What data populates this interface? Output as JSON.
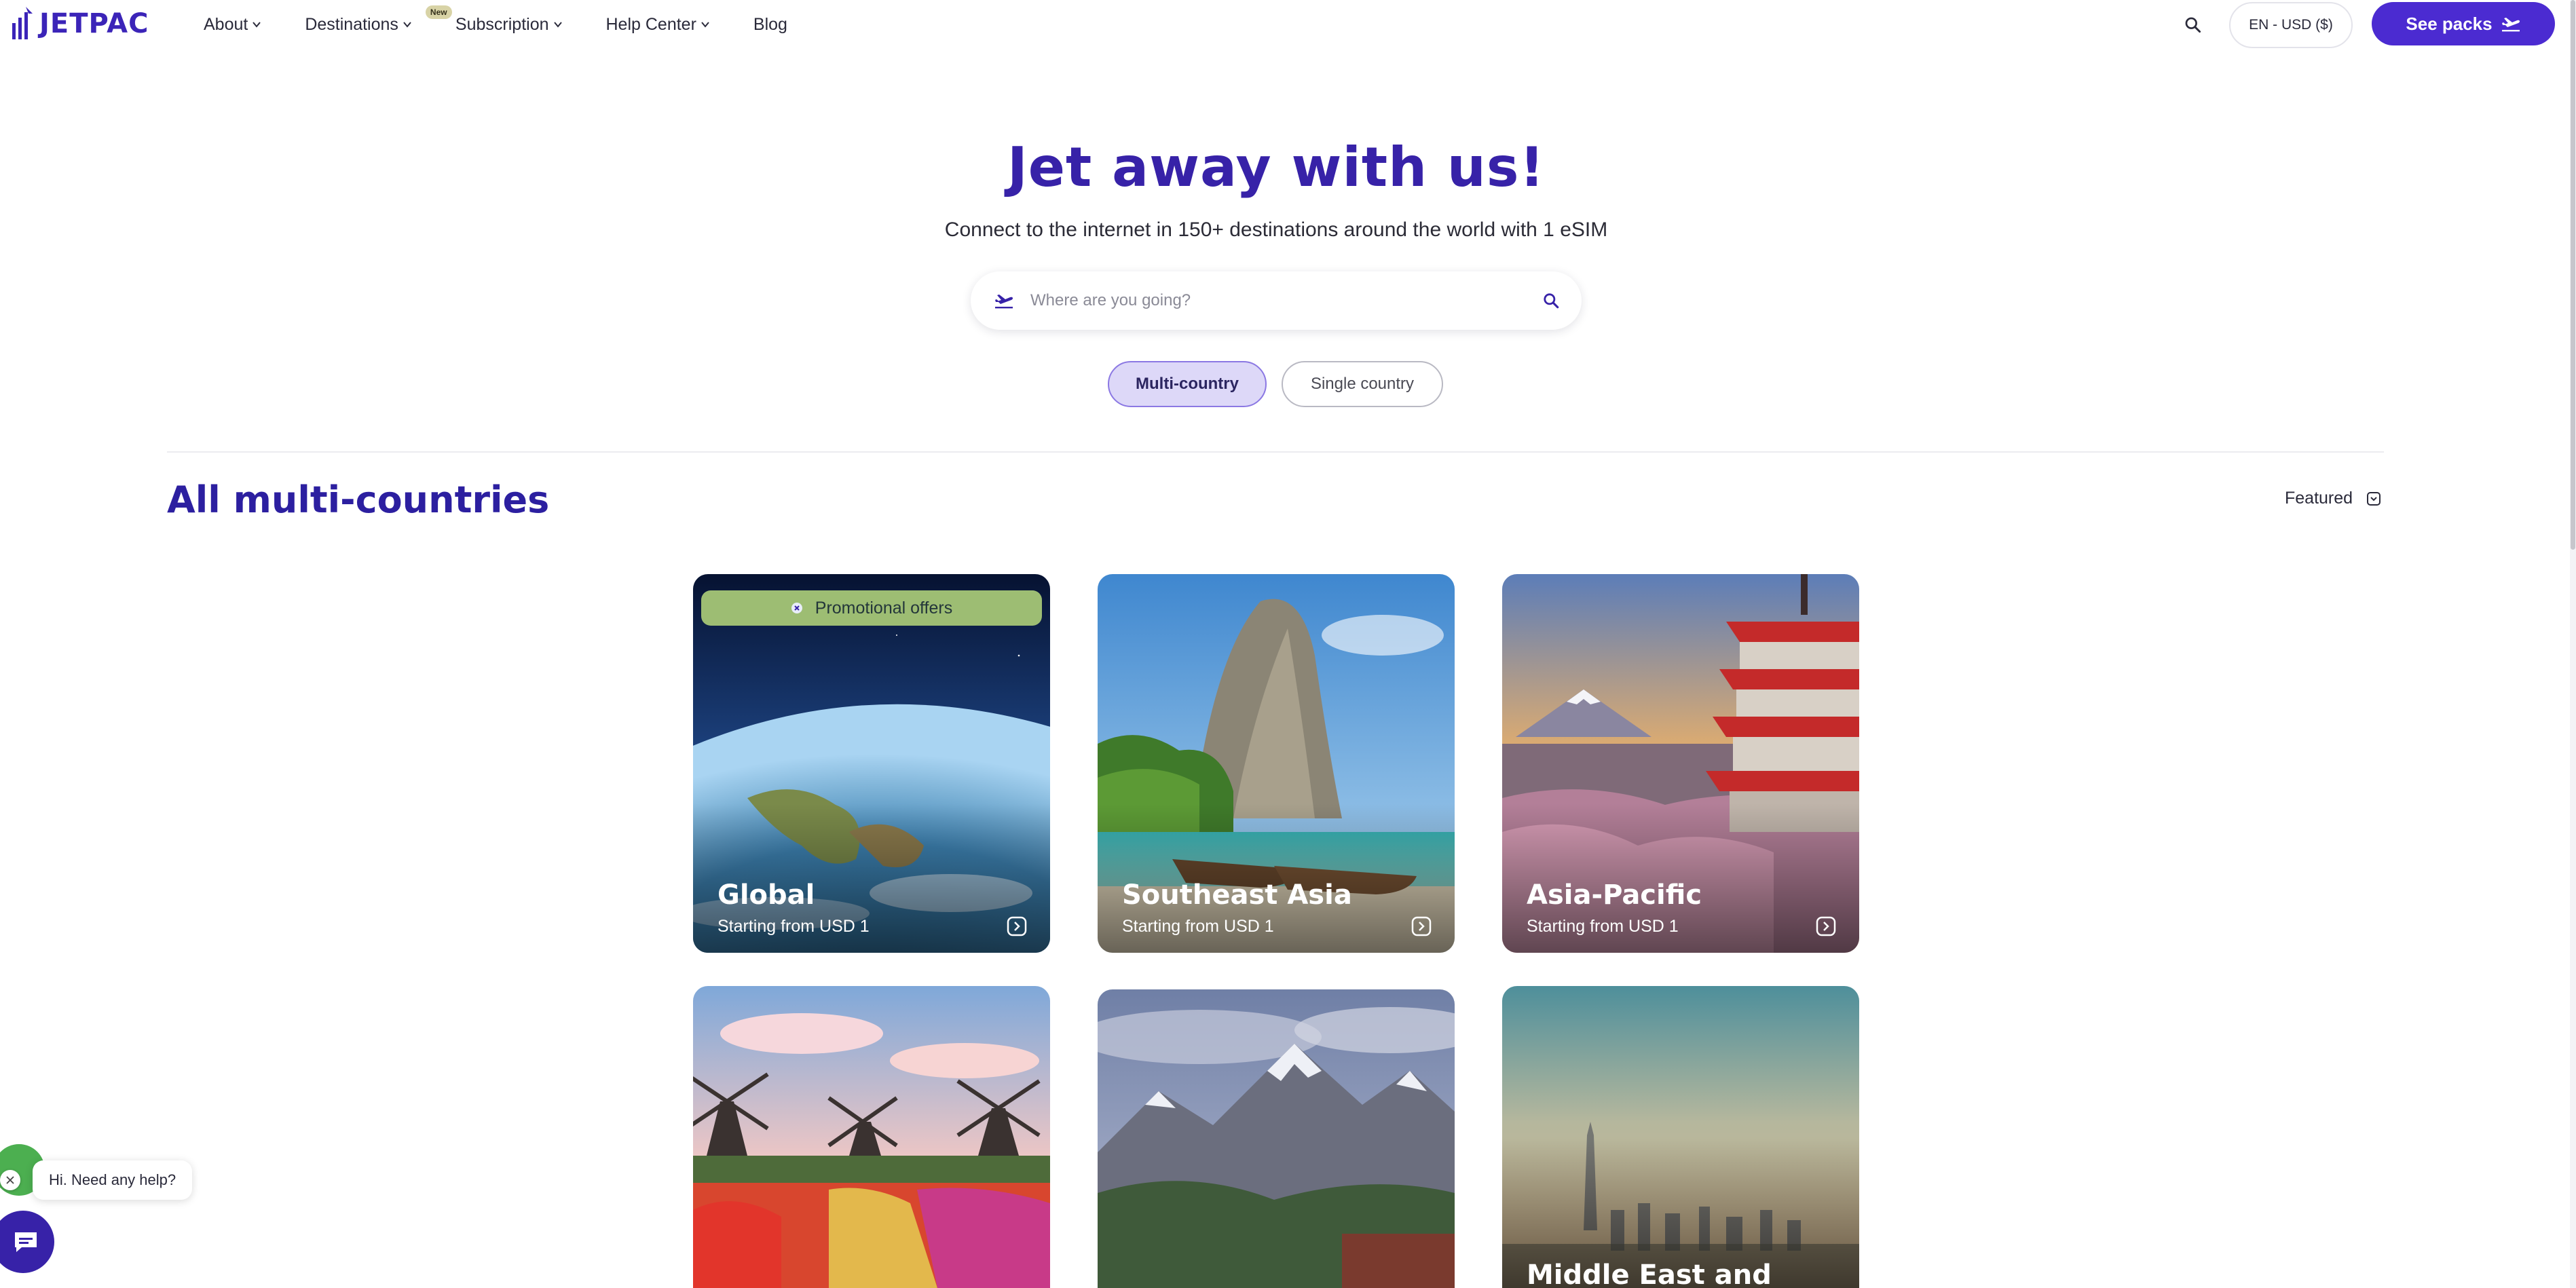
{
  "header": {
    "logo_text": "JETPAC",
    "nav": [
      {
        "label": "About",
        "has_menu": true
      },
      {
        "label": "Destinations",
        "has_menu": true
      },
      {
        "label": "Subscription",
        "has_menu": true,
        "badge": "New"
      },
      {
        "label": "Help Center",
        "has_menu": true
      },
      {
        "label": "Blog",
        "has_menu": false
      }
    ],
    "language_currency": "EN - USD ($)",
    "cta_label": "See packs"
  },
  "hero": {
    "title": "Jet away with us!",
    "subtitle": "Connect to the internet in 150+ destinations around the world with 1 eSIM",
    "search_placeholder": "Where are you going?",
    "toggles": [
      "Multi-country",
      "Single country"
    ],
    "active_toggle": "Multi-country"
  },
  "section": {
    "title": "All multi-countries",
    "sort_label": "Featured"
  },
  "cards": [
    {
      "name": "Global",
      "price": "Starting from USD 1",
      "promo": "Promotional offers"
    },
    {
      "name": "Southeast Asia",
      "price": "Starting from USD 1"
    },
    {
      "name": "Asia-Pacific",
      "price": "Starting from USD 1"
    },
    {
      "name": ""
    },
    {
      "name": ""
    },
    {
      "name": "Middle East and"
    }
  ],
  "chat": {
    "greeting": "Hi. Need any help?"
  },
  "colors": {
    "brand": "#3722a8",
    "cta": "#4b2bd1",
    "active_toggle_bg": "#ddd8f8",
    "promo_bg": "#9dbd73"
  }
}
